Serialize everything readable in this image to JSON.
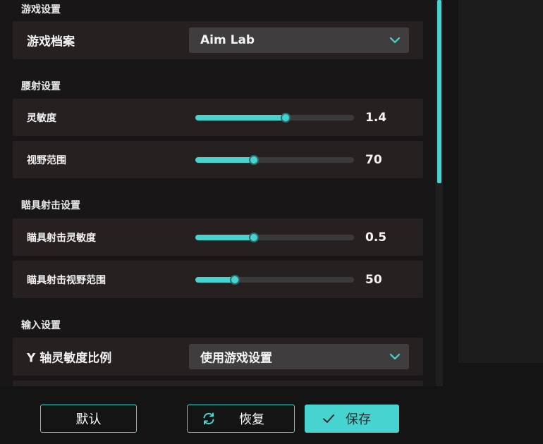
{
  "sections": {
    "game": "游戏设置",
    "hipfire": "腰射设置",
    "ads": "瞄具射击设置",
    "input": "输入设置"
  },
  "game_profile": {
    "label": "游戏档案",
    "value": "Aim Lab"
  },
  "hipfire": {
    "sensitivity": {
      "label": "灵敏度",
      "value": "1.4",
      "fraction": 0.57
    },
    "fov": {
      "label": "视野范围",
      "value": "70",
      "fraction": 0.37
    }
  },
  "ads": {
    "sensitivity": {
      "label": "瞄具射击灵敏度",
      "value": "0.5",
      "fraction": 0.37
    },
    "fov": {
      "label": "瞄具射击视野范围",
      "value": "50",
      "fraction": 0.25
    }
  },
  "input": {
    "y_ratio_label": "Y 轴灵敏度比例",
    "y_ratio_value": "使用游戏设置"
  },
  "buttons": {
    "default": "默认",
    "restore": "恢复",
    "save": "保存"
  },
  "colors": {
    "accent": "#47d4d0",
    "row_bg": "#262020",
    "page_bg": "#141414"
  },
  "icons": {
    "chevron": "chevron-down-icon",
    "restore": "refresh-icon",
    "save": "check-icon"
  }
}
